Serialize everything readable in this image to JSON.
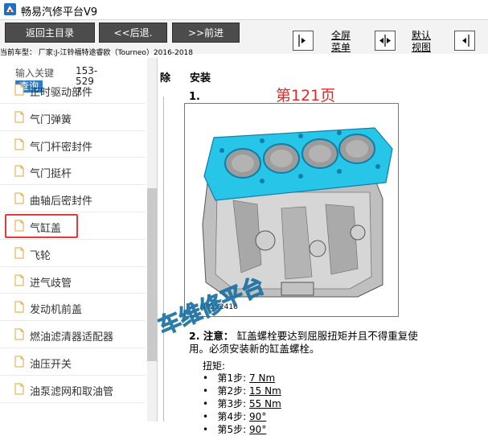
{
  "window": {
    "title": "畅易汽修平台V9",
    "icon": "app-logo-icon"
  },
  "toolbar": {
    "back_main": "返回主目录",
    "prev": "<<后退.",
    "next": ">>前进",
    "fullscreen_line1": "全屏",
    "fullscreen_line2": "菜单",
    "default_line1": "默认",
    "default_line2": "视图"
  },
  "vehicle": {
    "text": "当前车型： 厂家:J-江铃福特途睿欧（Tourneo）2016-2018"
  },
  "sidebar": {
    "search_label": "输入关键",
    "search_value": "153-5297",
    "search_button": "查询",
    "items": [
      {
        "label": "正时驱动部件"
      },
      {
        "label": "气门弹簧"
      },
      {
        "label": "气门杆密封件"
      },
      {
        "label": "气门挺杆"
      },
      {
        "label": "曲轴后密封件"
      },
      {
        "label": "气缸盖",
        "selected": true
      },
      {
        "label": "飞轮"
      },
      {
        "label": "进气歧管"
      },
      {
        "label": "发动机前盖"
      },
      {
        "label": "燃油滤清器适配器"
      },
      {
        "label": "油压开关"
      },
      {
        "label": "油泵滤网和取油管"
      }
    ]
  },
  "content": {
    "tab_removal": "除",
    "tab_install": "安装",
    "page_badge": "第121页",
    "step1": "1.",
    "figure_code": "N0152416",
    "step2_num": "2.",
    "step2_note": "注意：",
    "step2_text": "缸盖螺栓要达到屈服扭矩并且不得重复使用。必须安装新的缸盖螺栓。",
    "torque_title": "扭矩:",
    "torque_steps": [
      {
        "label": "第1步:",
        "value": "7 Nm"
      },
      {
        "label": "第2步:",
        "value": "15 Nm"
      },
      {
        "label": "第3步:",
        "value": "55 Nm"
      },
      {
        "label": "第4步:",
        "value": "90°"
      },
      {
        "label": "第5步:",
        "value": "90°"
      }
    ],
    "watermark": "车维修平台"
  },
  "colors": {
    "accent": "#2c7cc5",
    "highlight": "#e23b3b",
    "toolbar_button": "#4c4c4c",
    "cylinder_head": "#27c5e8"
  }
}
